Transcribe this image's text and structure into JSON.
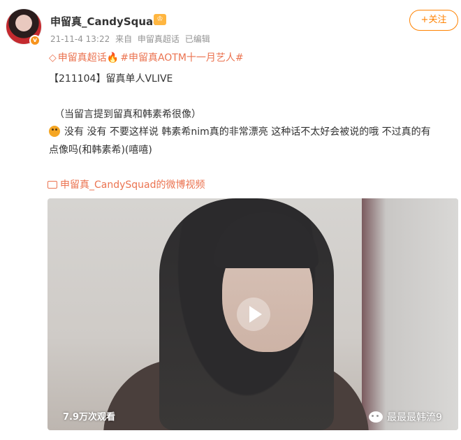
{
  "post": {
    "username": "申留真_CandySquad",
    "vip_badge": "♔",
    "timestamp": "21-11-4 13:22",
    "source_prefix": "来自",
    "source": "申留真超话",
    "edited": "已编辑",
    "follow_label": "+关注"
  },
  "topics": {
    "super_topic": "申留真超话",
    "hashtag": "#申留真AOTM十一月艺人#"
  },
  "content": {
    "line1": "【211104】留真单人VLIVE",
    "line2": "（当留言提到留真和韩素希很像）",
    "line3": "没有 没有 不要这样说 韩素希nim真的非常漂亮 这种话不太好会被说的哦 不过真的有",
    "line4": "点像吗(和韩素希)(嘻嘻)"
  },
  "video": {
    "link_label": "申留真_CandySquad的微博视频",
    "view_count": "7.9万次观看",
    "watermark": "最最最韩流9"
  },
  "icons": {
    "vip_badge": "crown-icon",
    "topic": "diamond-icon",
    "emoji": "cat-face-icon",
    "video_link": "video-icon",
    "play": "play-icon",
    "watermark": "wechat-icon"
  },
  "colors": {
    "accent": "#ff8200",
    "link": "#eb7350",
    "meta": "#939393"
  }
}
